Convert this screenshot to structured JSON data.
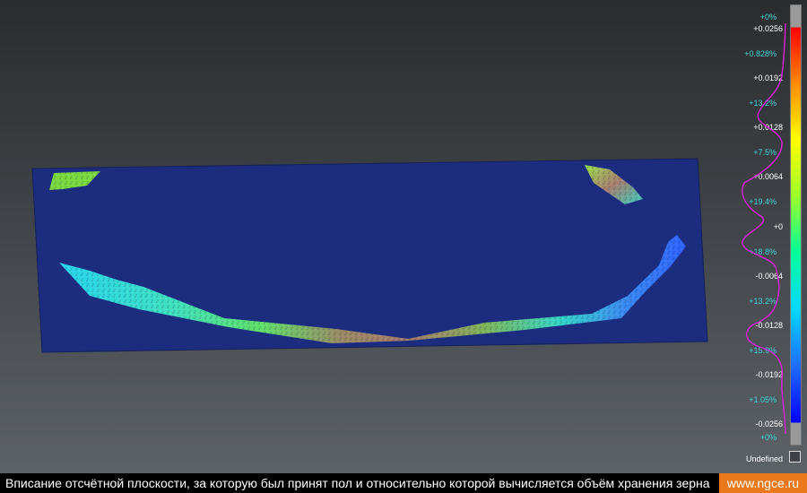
{
  "scale": {
    "top_values": [
      {
        "pct": "+0%",
        "val": "+0.0256"
      },
      {
        "pct": "+0.828%",
        "val": "+0.0192"
      },
      {
        "pct": "+13.2%",
        "val": "+0.0128"
      },
      {
        "pct": "+7.5%",
        "val": "+0.0064"
      },
      {
        "pct": "+19.4%",
        "val": "+0"
      },
      {
        "pct": "+18.8%",
        "val": "-0.0064"
      },
      {
        "pct": "+13.2%",
        "val": "-0.0128"
      },
      {
        "pct": "+15.9%",
        "val": "-0.0192"
      },
      {
        "pct": "+1.05%",
        "val": "-0.0256"
      },
      {
        "pct": "+0%",
        "val": ""
      }
    ],
    "undefined_label": "Undefined",
    "colors": [
      "#ff0000",
      "#ff8a00",
      "#ffff00",
      "#9bff2a",
      "#00ff9a",
      "#00d8ff",
      "#1f6cff",
      "#0000ff"
    ],
    "histogram_color": "#e020e0"
  },
  "footer": {
    "caption": "Вписание отсчётной плоскости, за которую был принят пол и относительно которой вычисляется объём хранения зерна",
    "site": "www.ngce.ru"
  },
  "scene": {
    "plane_color": "#1c2d80"
  }
}
